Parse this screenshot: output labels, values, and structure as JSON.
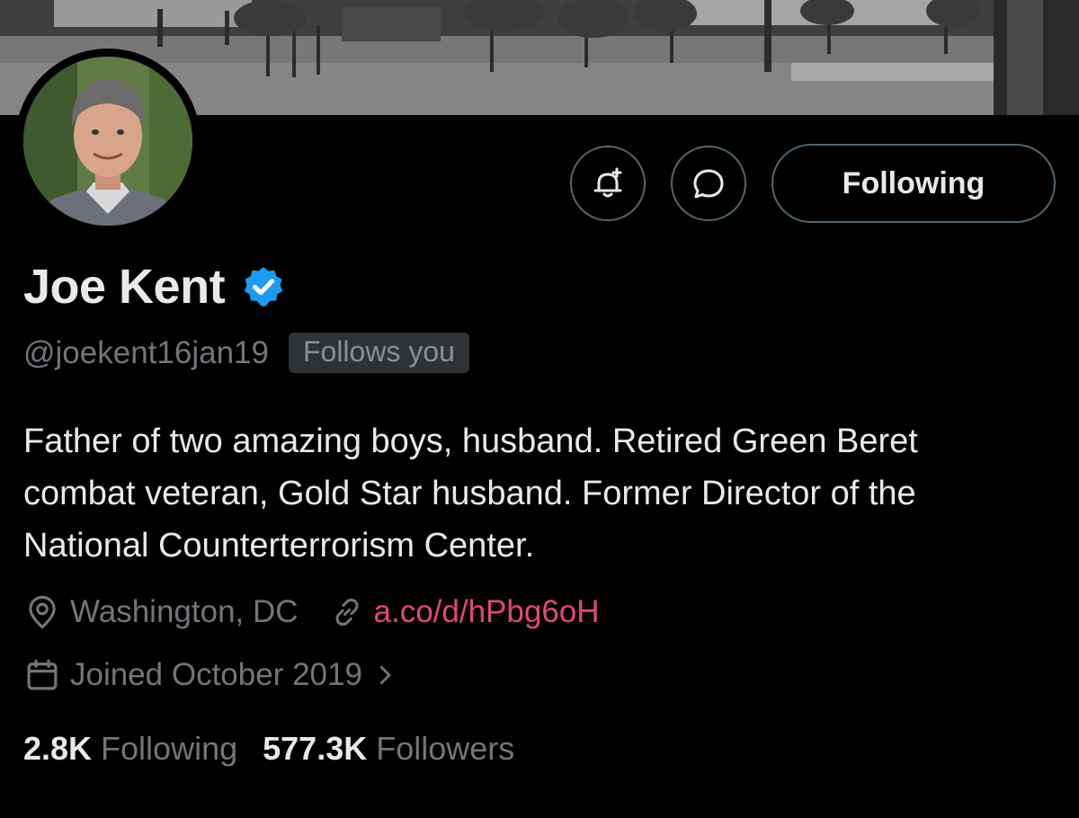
{
  "profile": {
    "display_name": "Joe Kent",
    "handle": "@joekent16jan19",
    "follows_you_badge": "Follows you",
    "bio": "Father of two amazing boys, husband. Retired Green Beret combat veteran, Gold Star husband. Former Director of the National Counterterrorism Center.",
    "location": "Washington, DC",
    "link": "a.co/d/hPbg6oH",
    "joined": "Joined October 2019"
  },
  "actions": {
    "following_label": "Following"
  },
  "stats": {
    "following_count": "2.8K",
    "following_label": "Following",
    "followers_count": "577.3K",
    "followers_label": "Followers"
  },
  "icons": {
    "notify": "bell-plus-icon",
    "message": "message-bubble-icon",
    "verified": "verified-badge-icon",
    "location": "location-pin-icon",
    "link": "link-icon",
    "calendar": "calendar-icon",
    "chevron": "chevron-right-icon"
  },
  "colors": {
    "background": "#000000",
    "text_primary": "#e7e9ea",
    "text_secondary": "#71767b",
    "border": "#536471",
    "verified_blue": "#1d9bf0",
    "link_pink": "#e3477a",
    "badge_bg": "#2f3336"
  }
}
